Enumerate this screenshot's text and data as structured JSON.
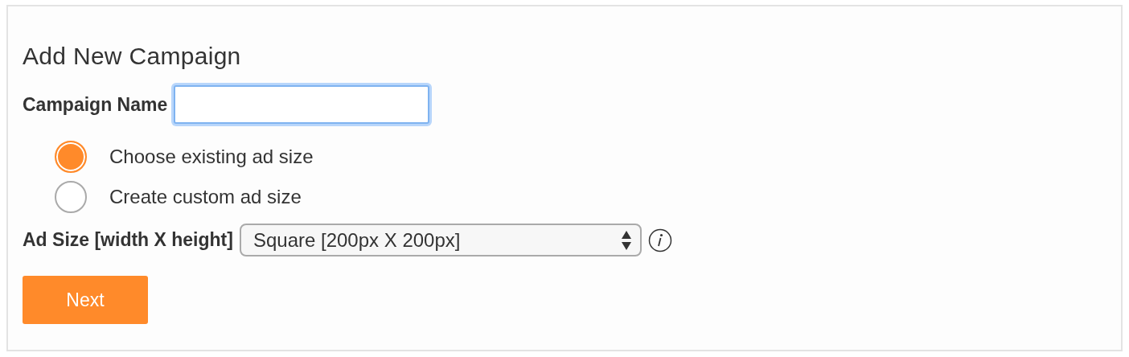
{
  "title": "Add New Campaign",
  "campaign_name": {
    "label": "Campaign Name",
    "focused": true
  },
  "size_options": [
    {
      "label": "Choose existing ad size",
      "selected": true
    },
    {
      "label": "Create custom ad size",
      "selected": false
    }
  ],
  "ad_size": {
    "label": "Ad Size [width X height]",
    "value": "Square [200px X 200px]"
  },
  "next_button": {
    "label": "Next"
  }
}
